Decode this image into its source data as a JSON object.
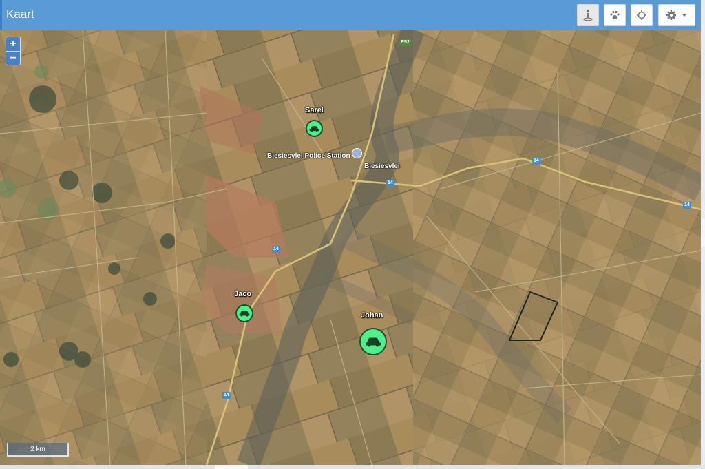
{
  "header": {
    "title": "Kaart",
    "buttons": [
      {
        "name": "street-view-button",
        "icon": "pegman-icon"
      },
      {
        "name": "paw-button",
        "icon": "paw-icon"
      },
      {
        "name": "locate-button",
        "icon": "crosshair-icon"
      },
      {
        "name": "settings-button",
        "icon": "gear-icon"
      }
    ]
  },
  "zoom": {
    "in_label": "+",
    "out_label": "−"
  },
  "scale": {
    "label": "2 km"
  },
  "places": {
    "police_station": "Biesiesvlei Police Station",
    "town": "Biesiesvlei"
  },
  "roads": {
    "r14": "14",
    "r52": "R52"
  },
  "vehicles": [
    {
      "name": "Sarel",
      "icon": "car-icon"
    },
    {
      "name": "Jaco",
      "icon": "car-icon"
    },
    {
      "name": "Johan",
      "icon": "car-icon"
    }
  ],
  "colors": {
    "header": "#5b9bd5",
    "marker_fill": "#4ef08a",
    "road": "#d8c27a"
  }
}
